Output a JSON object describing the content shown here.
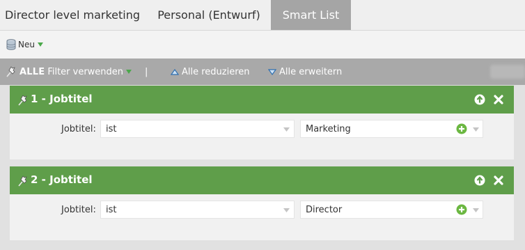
{
  "tabs": [
    {
      "label": "Director level marketing",
      "active": false
    },
    {
      "label": "Personal (Entwurf)",
      "active": false
    },
    {
      "label": "Smart List",
      "active": true
    }
  ],
  "toolbar": {
    "new_label": "Neu",
    "new_icon": "database-icon"
  },
  "filter_bar": {
    "use_all_bold": "ALLE",
    "use_all_rest": "Filter verwenden",
    "separator": "|",
    "collapse_all": "Alle reduzieren",
    "expand_all": "Alle erweitern"
  },
  "filters": [
    {
      "title": "1 - Jobtitel",
      "field_label": "Jobtitel:",
      "operator": "ist",
      "value": "Marketing"
    },
    {
      "title": "2 - Jobtitel",
      "field_label": "Jobtitel:",
      "operator": "ist",
      "value": "Director"
    }
  ],
  "colors": {
    "header_green": "#5f9e4a",
    "active_tab": "#a5a5a5",
    "filter_bar": "#a9a9a9",
    "plus_green": "#6bb741",
    "caret_blue": "#3a7fc1"
  }
}
